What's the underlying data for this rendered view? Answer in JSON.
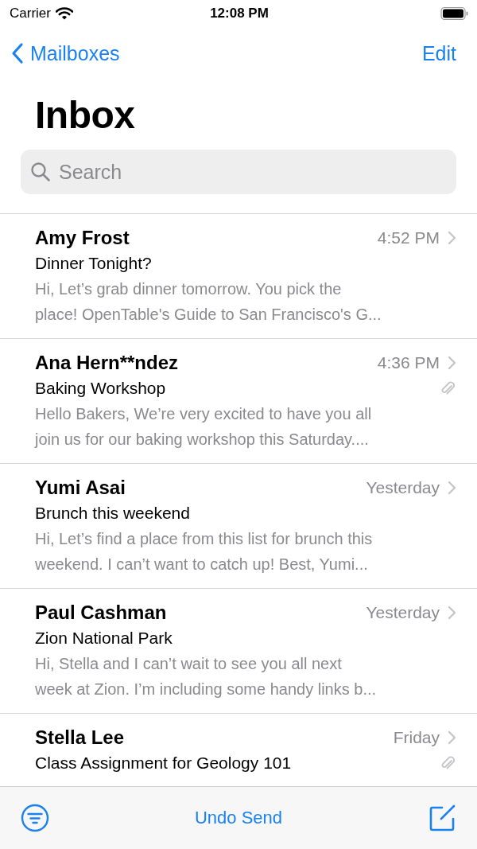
{
  "status_bar": {
    "carrier": "Carrier",
    "time": "12:08 PM"
  },
  "nav": {
    "back": "Mailboxes",
    "action": "Edit"
  },
  "title": "Inbox",
  "search": {
    "placeholder": "Search"
  },
  "messages": [
    {
      "sender": "Amy Frost",
      "time": "4:52 PM",
      "subject": "Dinner Tonight?",
      "preview": [
        "Hi, Let’s grab dinner tomorrow. You pick the",
        "place! OpenTable's Guide to San Francisco's G..."
      ],
      "attachment": false
    },
    {
      "sender": "Ana Hern**ndez",
      "time": "4:36 PM",
      "subject": "Baking Workshop",
      "preview": [
        "Hello Bakers, We’re very excited to have you all",
        "join us for our baking workshop this Saturday...."
      ],
      "attachment": true
    },
    {
      "sender": "Yumi Asai",
      "time": "Yesterday",
      "subject": "Brunch this weekend",
      "preview": [
        "Hi, Let’s find a place from this list for brunch this",
        "weekend. I can’t want to catch up! Best, Yumi..."
      ],
      "attachment": false
    },
    {
      "sender": "Paul Cashman",
      "time": "Yesterday",
      "subject": "Zion National Park",
      "preview": [
        "Hi, Stella and I can’t wait to see you all next",
        "week at Zion. I’m including some handy links b..."
      ],
      "attachment": false
    },
    {
      "sender": "Stella Lee",
      "time": "Friday",
      "subject": "Class Assignment for Geology 101",
      "attachment": true
    }
  ],
  "toolbar": {
    "status": "Undo Send"
  }
}
